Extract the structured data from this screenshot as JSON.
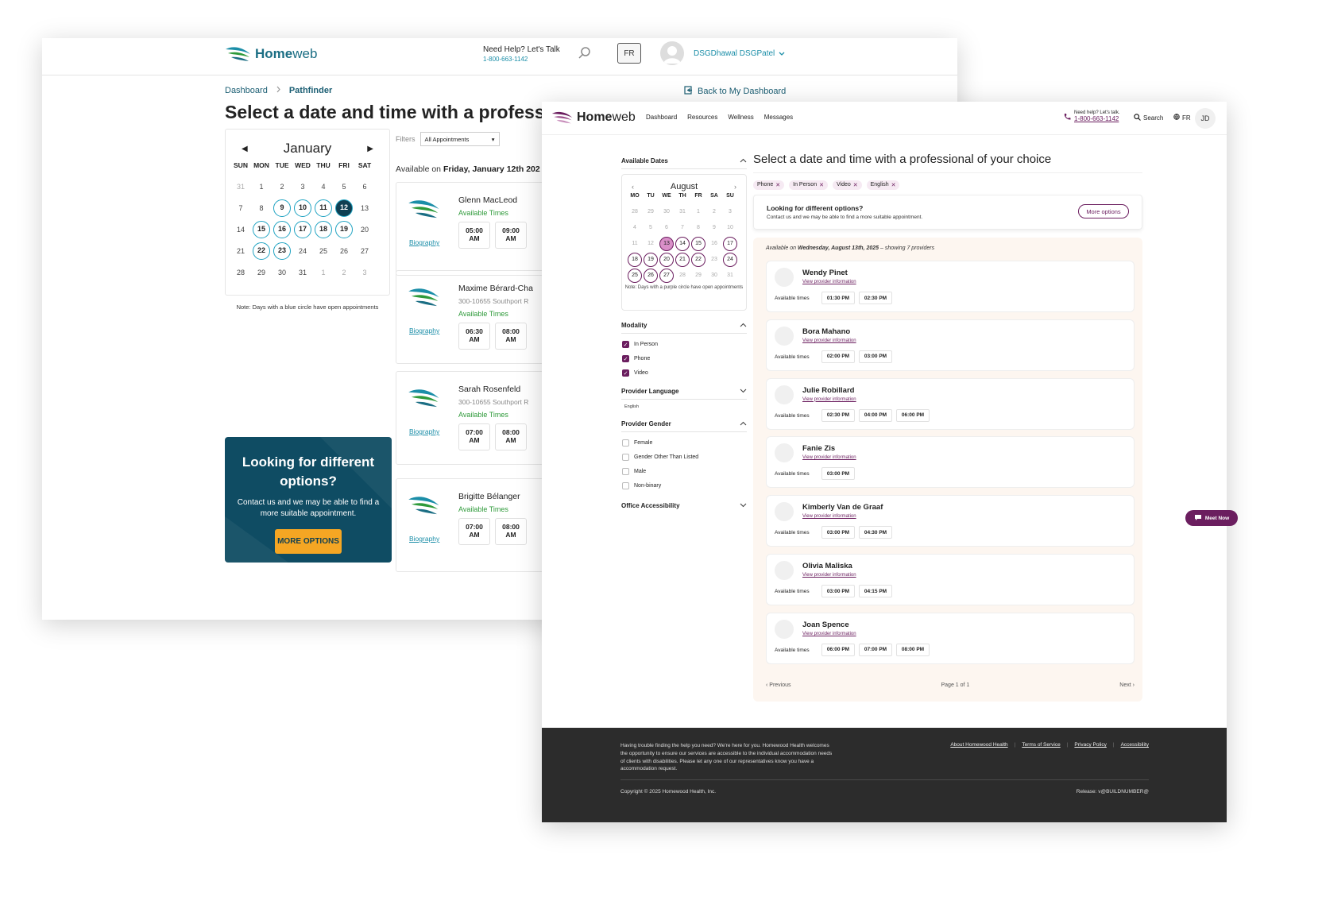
{
  "back": {
    "logo": {
      "part1": "Home",
      "part2": "web"
    },
    "help": {
      "title": "Need Help? Let's Talk",
      "phone": "1-800-663-1142"
    },
    "lang_button": "FR",
    "user_name": "DSGDhawal DSGPatel",
    "breadcrumb": {
      "home": "Dashboard",
      "current": "Pathfinder"
    },
    "back_link": "Back to My Dashboard",
    "title": "Select a date and time with a professional",
    "calendar": {
      "month": "January",
      "weekdays": [
        "SUN",
        "MON",
        "TUE",
        "WED",
        "THU",
        "FRI",
        "SAT"
      ],
      "days": [
        {
          "n": "31",
          "s": "muted"
        },
        {
          "n": "1",
          "s": ""
        },
        {
          "n": "2",
          "s": ""
        },
        {
          "n": "3",
          "s": ""
        },
        {
          "n": "4",
          "s": ""
        },
        {
          "n": "5",
          "s": ""
        },
        {
          "n": "6",
          "s": ""
        },
        {
          "n": "7",
          "s": ""
        },
        {
          "n": "8",
          "s": ""
        },
        {
          "n": "9",
          "s": "avail"
        },
        {
          "n": "10",
          "s": "avail"
        },
        {
          "n": "11",
          "s": "avail"
        },
        {
          "n": "12",
          "s": "sel"
        },
        {
          "n": "13",
          "s": ""
        },
        {
          "n": "14",
          "s": ""
        },
        {
          "n": "15",
          "s": "avail"
        },
        {
          "n": "16",
          "s": "avail"
        },
        {
          "n": "17",
          "s": "avail"
        },
        {
          "n": "18",
          "s": "avail"
        },
        {
          "n": "19",
          "s": "avail"
        },
        {
          "n": "20",
          "s": ""
        },
        {
          "n": "21",
          "s": ""
        },
        {
          "n": "22",
          "s": "avail"
        },
        {
          "n": "23",
          "s": "avail"
        },
        {
          "n": "24",
          "s": ""
        },
        {
          "n": "25",
          "s": ""
        },
        {
          "n": "26",
          "s": ""
        },
        {
          "n": "27",
          "s": ""
        },
        {
          "n": "28",
          "s": ""
        },
        {
          "n": "29",
          "s": ""
        },
        {
          "n": "30",
          "s": ""
        },
        {
          "n": "31",
          "s": ""
        },
        {
          "n": "1",
          "s": "muted"
        },
        {
          "n": "2",
          "s": "muted"
        },
        {
          "n": "3",
          "s": "muted"
        }
      ],
      "note": "Note: Days with a blue circle have open appointments"
    },
    "filters": {
      "label": "Filters",
      "selected": "All Appointments"
    },
    "available_on": {
      "prefix": "Available on ",
      "date": "Friday, January 12th 202"
    },
    "providers": [
      {
        "name": "Glenn MacLeod",
        "address": "",
        "avail": "Available Times",
        "bio": "Biography",
        "slots": [
          [
            "05:00",
            "AM"
          ],
          [
            "09:00",
            "AM"
          ]
        ]
      },
      {
        "name": "Maxime Bérard-Cha",
        "address": "300-10655 Southport R",
        "avail": "Available Times",
        "bio": "Biography",
        "slots": [
          [
            "06:30",
            "AM"
          ],
          [
            "08:00",
            "AM"
          ]
        ]
      },
      {
        "name": "Sarah Rosenfeld",
        "address": "300-10655 Southport R",
        "avail": "Available Times",
        "bio": "Biography",
        "slots": [
          [
            "07:00",
            "AM"
          ],
          [
            "08:00",
            "AM"
          ]
        ]
      },
      {
        "name": "Brigitte Bélanger",
        "address": "",
        "avail": "Available Times",
        "bio": "Biography",
        "slots": [
          [
            "07:00",
            "AM"
          ],
          [
            "08:00",
            "AM"
          ]
        ]
      }
    ],
    "promo": {
      "title": "Looking for different options?",
      "desc": "Contact us and we may be able to find a more suitable appointment.",
      "button": "MORE OPTIONS"
    }
  },
  "front": {
    "logo": {
      "part1": "Home",
      "part2": "web"
    },
    "nav": [
      "Dashboard",
      "Resources",
      "Wellness",
      "Messages"
    ],
    "help": {
      "title": "Need help? Let's talk.",
      "phone": "1-800-663-1142"
    },
    "search": "Search",
    "lang": "FR",
    "avatar": "JD",
    "sidebar": {
      "dates_title": "Available Dates",
      "calendar": {
        "month": "August",
        "weekdays": [
          "MO",
          "TU",
          "WE",
          "TH",
          "FR",
          "SA",
          "SU"
        ],
        "days": [
          {
            "n": "28",
            "s": ""
          },
          {
            "n": "29",
            "s": ""
          },
          {
            "n": "30",
            "s": ""
          },
          {
            "n": "31",
            "s": ""
          },
          {
            "n": "1",
            "s": ""
          },
          {
            "n": "2",
            "s": ""
          },
          {
            "n": "3",
            "s": ""
          },
          {
            "n": "4",
            "s": ""
          },
          {
            "n": "5",
            "s": ""
          },
          {
            "n": "6",
            "s": ""
          },
          {
            "n": "7",
            "s": ""
          },
          {
            "n": "8",
            "s": ""
          },
          {
            "n": "9",
            "s": ""
          },
          {
            "n": "10",
            "s": ""
          },
          {
            "n": "11",
            "s": ""
          },
          {
            "n": "12",
            "s": ""
          },
          {
            "n": "13",
            "s": "sel"
          },
          {
            "n": "14",
            "s": "avail"
          },
          {
            "n": "15",
            "s": "avail"
          },
          {
            "n": "16",
            "s": ""
          },
          {
            "n": "17",
            "s": "avail"
          },
          {
            "n": "18",
            "s": "avail"
          },
          {
            "n": "19",
            "s": "avail"
          },
          {
            "n": "20",
            "s": "avail"
          },
          {
            "n": "21",
            "s": "avail"
          },
          {
            "n": "22",
            "s": "avail"
          },
          {
            "n": "23",
            "s": ""
          },
          {
            "n": "24",
            "s": "avail"
          },
          {
            "n": "25",
            "s": "avail"
          },
          {
            "n": "26",
            "s": "avail"
          },
          {
            "n": "27",
            "s": "avail"
          },
          {
            "n": "28",
            "s": ""
          },
          {
            "n": "29",
            "s": ""
          },
          {
            "n": "30",
            "s": ""
          },
          {
            "n": "31",
            "s": ""
          }
        ],
        "note": "Note: Days with a purple circle have open appointments"
      },
      "modality_title": "Modality",
      "modality": [
        {
          "label": "In Person",
          "checked": true
        },
        {
          "label": "Phone",
          "checked": true
        },
        {
          "label": "Video",
          "checked": true
        }
      ],
      "language_title": "Provider Language",
      "language_value": "English",
      "gender_title": "Provider Gender",
      "gender": [
        {
          "label": "Female",
          "checked": false
        },
        {
          "label": "Gender Other Than Listed",
          "checked": false
        },
        {
          "label": "Male",
          "checked": false
        },
        {
          "label": "Non-binary",
          "checked": false
        }
      ],
      "office_title": "Office Accessibility"
    },
    "title": "Select a date and time with a professional of your choice",
    "chips": [
      "Phone",
      "In Person",
      "Video",
      "English"
    ],
    "options": {
      "title": "Looking for different options?",
      "desc": "Contact us and we may be able to find a more suitable appointment.",
      "button": "More options"
    },
    "list_heading": {
      "prefix": "Available on ",
      "date": "Wednesday, August 13th, 2025",
      "suffix": " – showing 7 providers"
    },
    "available_label": "Available times",
    "view_label": "View provider information",
    "providers": [
      {
        "name": "Wendy Pinet",
        "slots": [
          "01:30 PM",
          "02:30 PM"
        ]
      },
      {
        "name": "Bora Mahano",
        "slots": [
          "02:00 PM",
          "03:00 PM"
        ]
      },
      {
        "name": "Julie Robillard",
        "slots": [
          "02:30 PM",
          "04:00 PM",
          "06:00 PM"
        ]
      },
      {
        "name": "Fanie Zis",
        "slots": [
          "03:00 PM"
        ]
      },
      {
        "name": "Kimberly Van de Graaf",
        "slots": [
          "03:00 PM",
          "04:30 PM"
        ]
      },
      {
        "name": "Olivia Maliska",
        "slots": [
          "03:00 PM",
          "04:15 PM"
        ]
      },
      {
        "name": "Joan Spence",
        "slots": [
          "06:00 PM",
          "07:00 PM",
          "08:00 PM"
        ]
      }
    ],
    "pager": {
      "prev": "Previous",
      "page": "Page 1 of 1",
      "next": "Next"
    },
    "footer": {
      "text": "Having trouble finding the help you need? We're here for you. Homewood Health welcomes the opportunity to ensure our services are accessible to the individual accommodation needs of clients with disabilities. Please let any one of our representatives know you have a accommodation request.",
      "links": [
        "About Homewood Health",
        "Terms of Service",
        "Privacy Policy",
        "Accessibility"
      ],
      "copyright": "Copyright © 2025 Homewood Health, Inc.",
      "release": "Release: v@BUILDNUMBER@"
    },
    "meet_now": "Meet Now"
  },
  "colors": {
    "teal": "#1b8ea8",
    "navy": "#0f4c63",
    "purple": "#6b1e5f",
    "orange": "#f5a623"
  }
}
